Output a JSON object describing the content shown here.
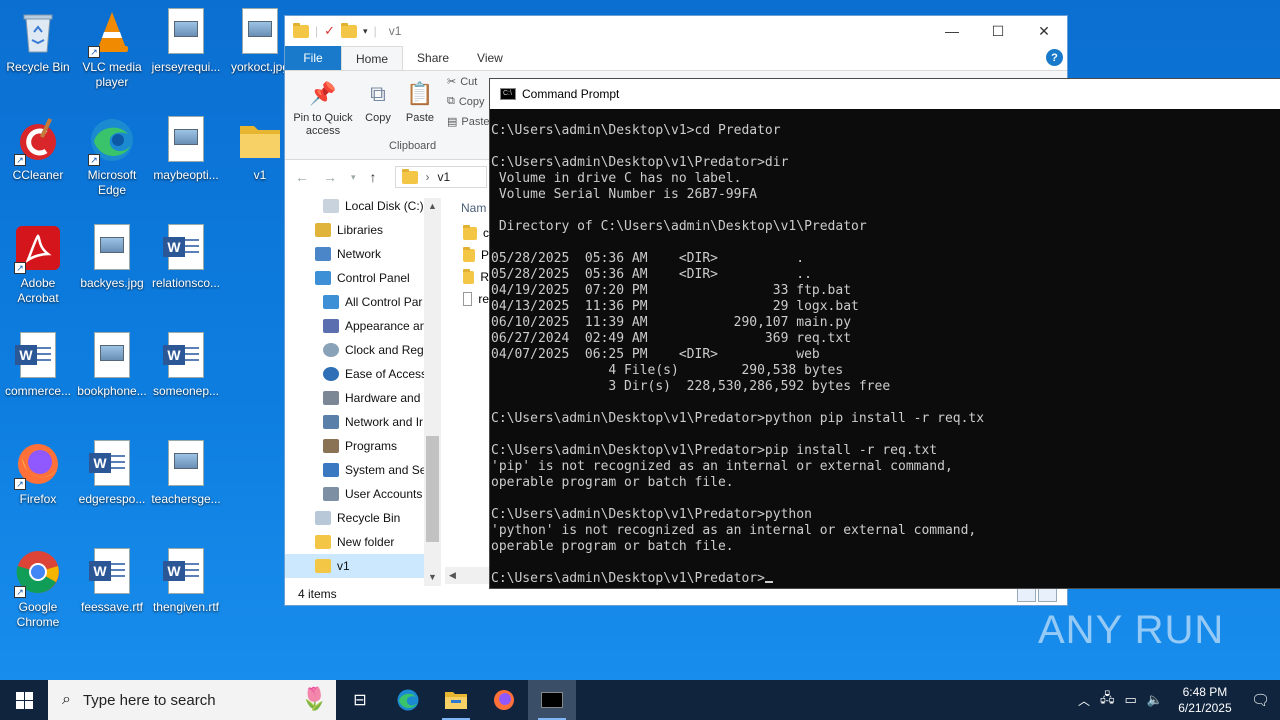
{
  "desktop": {
    "icons": [
      {
        "label": "Recycle Bin"
      },
      {
        "label": "VLC media player"
      },
      {
        "label": "jerseyrequi..."
      },
      {
        "label": "yorkoct.jpg"
      },
      {
        "label": "CCleaner"
      },
      {
        "label": "Microsoft Edge"
      },
      {
        "label": "maybeopti..."
      },
      {
        "label": "v1"
      },
      {
        "label": "Adobe Acrobat"
      },
      {
        "label": "backyes.jpg"
      },
      {
        "label": "relationsco..."
      },
      {
        "label": "commerce..."
      },
      {
        "label": "bookphone..."
      },
      {
        "label": "someonep..."
      },
      {
        "label": "Firefox"
      },
      {
        "label": "edgerespo..."
      },
      {
        "label": "teachersge..."
      },
      {
        "label": "Google Chrome"
      },
      {
        "label": "feessave.rtf"
      },
      {
        "label": "thengiven.rtf"
      }
    ]
  },
  "explorer": {
    "title": "v1",
    "tabs": {
      "file": "File",
      "home": "Home",
      "share": "Share",
      "view": "View"
    },
    "ribbon": {
      "pin": "Pin to Quick access",
      "copy": "Copy",
      "paste": "Paste",
      "cut": "Cut",
      "copy_path": "Copy",
      "paste_shortcut": "Paste",
      "group": "Clipboard"
    },
    "address": {
      "path": "v1"
    },
    "nav": [
      "Local Disk (C:)",
      "Libraries",
      "Network",
      "Control Panel",
      "All Control Par",
      "Appearance an",
      "Clock and Regi",
      "Ease of Access",
      "Hardware and :",
      "Network and Ir",
      "Programs",
      "System and Se",
      "User Accounts",
      "Recycle Bin",
      "New folder",
      "v1"
    ],
    "files_header": "Nam",
    "files": [
      "c",
      "P",
      "R",
      "re"
    ],
    "status": "4 items"
  },
  "cmd": {
    "title": "Command Prompt",
    "lines": [
      "C:\\Users\\admin\\Desktop\\v1>cd Predator",
      "",
      "C:\\Users\\admin\\Desktop\\v1\\Predator>dir",
      " Volume in drive C has no label.",
      " Volume Serial Number is 26B7-99FA",
      "",
      " Directory of C:\\Users\\admin\\Desktop\\v1\\Predator",
      "",
      "05/28/2025  05:36 AM    <DIR>          .",
      "05/28/2025  05:36 AM    <DIR>          ..",
      "04/19/2025  07:20 PM                33 ftp.bat",
      "04/13/2025  11:36 PM                29 logx.bat",
      "06/10/2025  11:39 AM           290,107 main.py",
      "06/27/2024  02:49 AM               369 req.txt",
      "04/07/2025  06:25 PM    <DIR>          web",
      "               4 File(s)        290,538 bytes",
      "               3 Dir(s)  228,530,286,592 bytes free",
      "",
      "C:\\Users\\admin\\Desktop\\v1\\Predator>python pip install -r req.tx",
      "",
      "C:\\Users\\admin\\Desktop\\v1\\Predator>pip install -r req.txt",
      "'pip' is not recognized as an internal or external command,",
      "operable program or batch file.",
      "",
      "C:\\Users\\admin\\Desktop\\v1\\Predator>python",
      "'python' is not recognized as an internal or external command,",
      "operable program or batch file.",
      ""
    ],
    "prompt": "C:\\Users\\admin\\Desktop\\v1\\Predator>"
  },
  "watermark": "ANY RUN",
  "taskbar": {
    "search_placeholder": "Type here to search",
    "time": "6:48 PM",
    "date": "6/21/2025"
  }
}
